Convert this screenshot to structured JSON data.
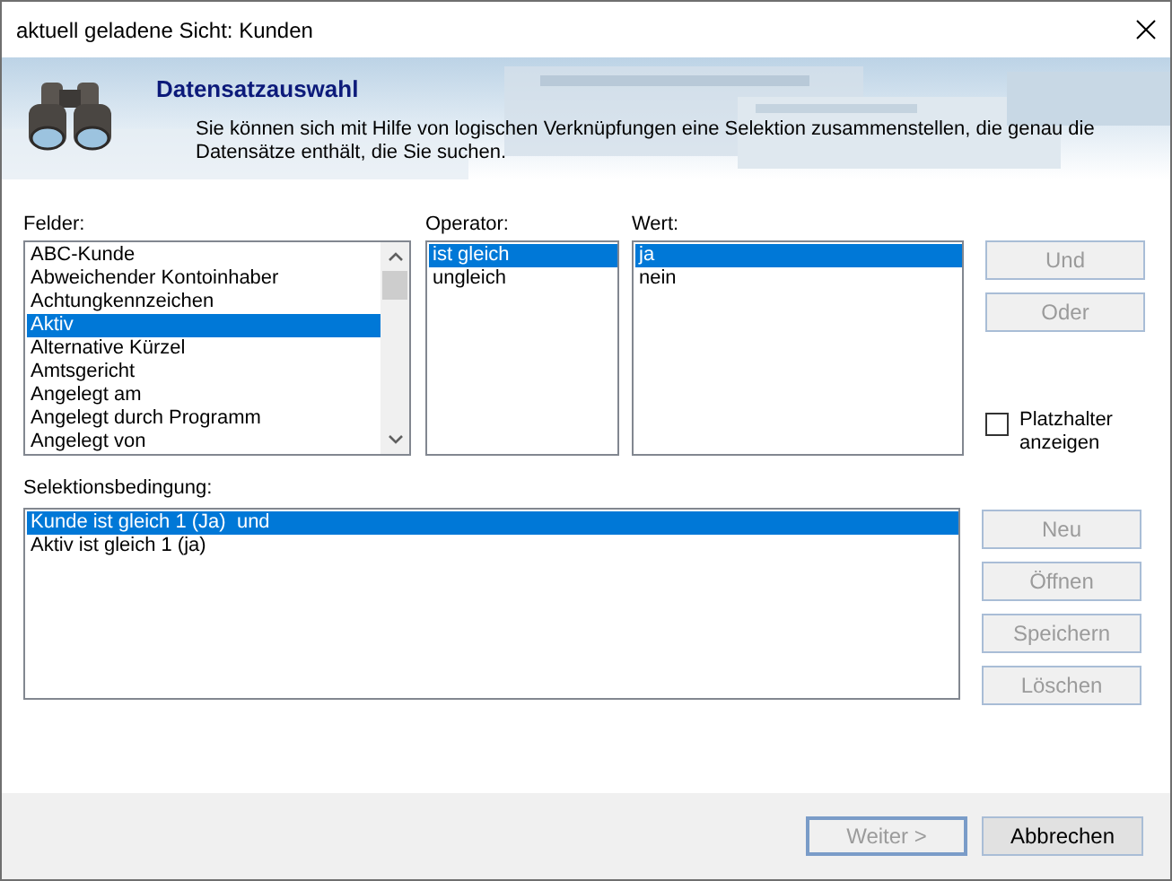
{
  "window": {
    "title": "aktuell geladene Sicht: Kunden"
  },
  "header": {
    "title": "Datensatzauswahl",
    "description": "Sie können sich mit Hilfe von logischen Verknüpfungen eine Selektion zusammenstellen, die genau die Datensätze enthält, die Sie suchen."
  },
  "fields": {
    "label": "Felder:",
    "items": [
      {
        "text": "ABC-Kunde",
        "selected": false
      },
      {
        "text": "Abweichender Kontoinhaber",
        "selected": false
      },
      {
        "text": "Achtungkennzeichen",
        "selected": false
      },
      {
        "text": "Aktiv",
        "selected": true
      },
      {
        "text": "Alternative Kürzel",
        "selected": false
      },
      {
        "text": "Amtsgericht",
        "selected": false
      },
      {
        "text": "Angelegt am",
        "selected": false
      },
      {
        "text": "Angelegt durch Programm",
        "selected": false
      },
      {
        "text": "Angelegt von",
        "selected": false
      }
    ]
  },
  "operator": {
    "label": "Operator:",
    "items": [
      {
        "text": "ist gleich",
        "selected": true
      },
      {
        "text": "ungleich",
        "selected": false
      }
    ]
  },
  "value": {
    "label": "Wert:",
    "items": [
      {
        "text": "ja",
        "selected": true
      },
      {
        "text": "nein",
        "selected": false
      }
    ]
  },
  "logic_buttons": [
    {
      "label": "Und",
      "disabled": true
    },
    {
      "label": "Oder",
      "disabled": true
    }
  ],
  "placeholder_checkbox": {
    "label": "Platzhalter anzeigen",
    "checked": false
  },
  "condition": {
    "label": "Selektionsbedingung:",
    "items": [
      {
        "text": "Kunde ist gleich 1 (Ja)  und",
        "selected": true
      },
      {
        "text": "Aktiv ist gleich 1 (ja)",
        "selected": false
      }
    ]
  },
  "condition_buttons": [
    {
      "label": "Neu",
      "disabled": true
    },
    {
      "label": "Öffnen",
      "disabled": true
    },
    {
      "label": "Speichern",
      "disabled": true
    },
    {
      "label": "Löschen",
      "disabled": true
    }
  ],
  "footer_buttons": [
    {
      "label": "Weiter >",
      "disabled": true,
      "default": true
    },
    {
      "label": "Abbrechen",
      "disabled": false,
      "default": false
    }
  ]
}
